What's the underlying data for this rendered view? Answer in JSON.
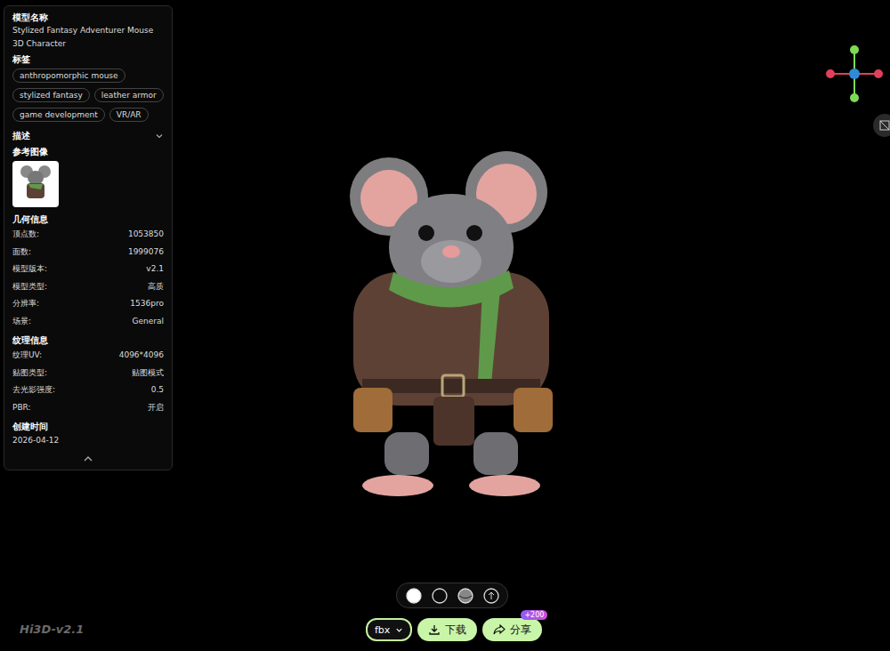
{
  "panel": {
    "name_label": "模型名称",
    "model_name": "Stylized Fantasy Adventurer Mouse 3D Character",
    "tags_label": "标签",
    "tags": [
      "anthropomorphic mouse",
      "stylized fantasy",
      "leather armor",
      "game development",
      "VR/AR"
    ],
    "description": {
      "label": "描述",
      "expanded": false
    },
    "reference_label": "参考图像",
    "geometry": {
      "label": "几何信息",
      "rows": [
        {
          "key": "顶点数:",
          "value": "1053850"
        },
        {
          "key": "面数:",
          "value": "1999076"
        },
        {
          "key": "模型版本:",
          "value": "v2.1"
        },
        {
          "key": "模型类型:",
          "value": "高质"
        },
        {
          "key": "分辨率:",
          "value": "1536pro"
        },
        {
          "key": "场景:",
          "value": "General"
        }
      ]
    },
    "texture": {
      "label": "纹理信息",
      "rows": [
        {
          "key": "纹理UV:",
          "value": "4096*4096"
        },
        {
          "key": "贴图类型:",
          "value": "贴图模式"
        },
        {
          "key": "去光影强度:",
          "value": "0.5"
        },
        {
          "key": "PBR:",
          "value": "开启"
        }
      ]
    },
    "created": {
      "label": "创建时间",
      "value": "2026-04-12"
    }
  },
  "watermark": "Hi3D-v2.1",
  "view_modes": [
    {
      "selected": true
    },
    {
      "selected": false
    },
    {
      "selected": false
    },
    {
      "selected": false
    }
  ],
  "format": "fbx",
  "download": "下载",
  "share": {
    "label": "分享",
    "badge": "+200"
  }
}
